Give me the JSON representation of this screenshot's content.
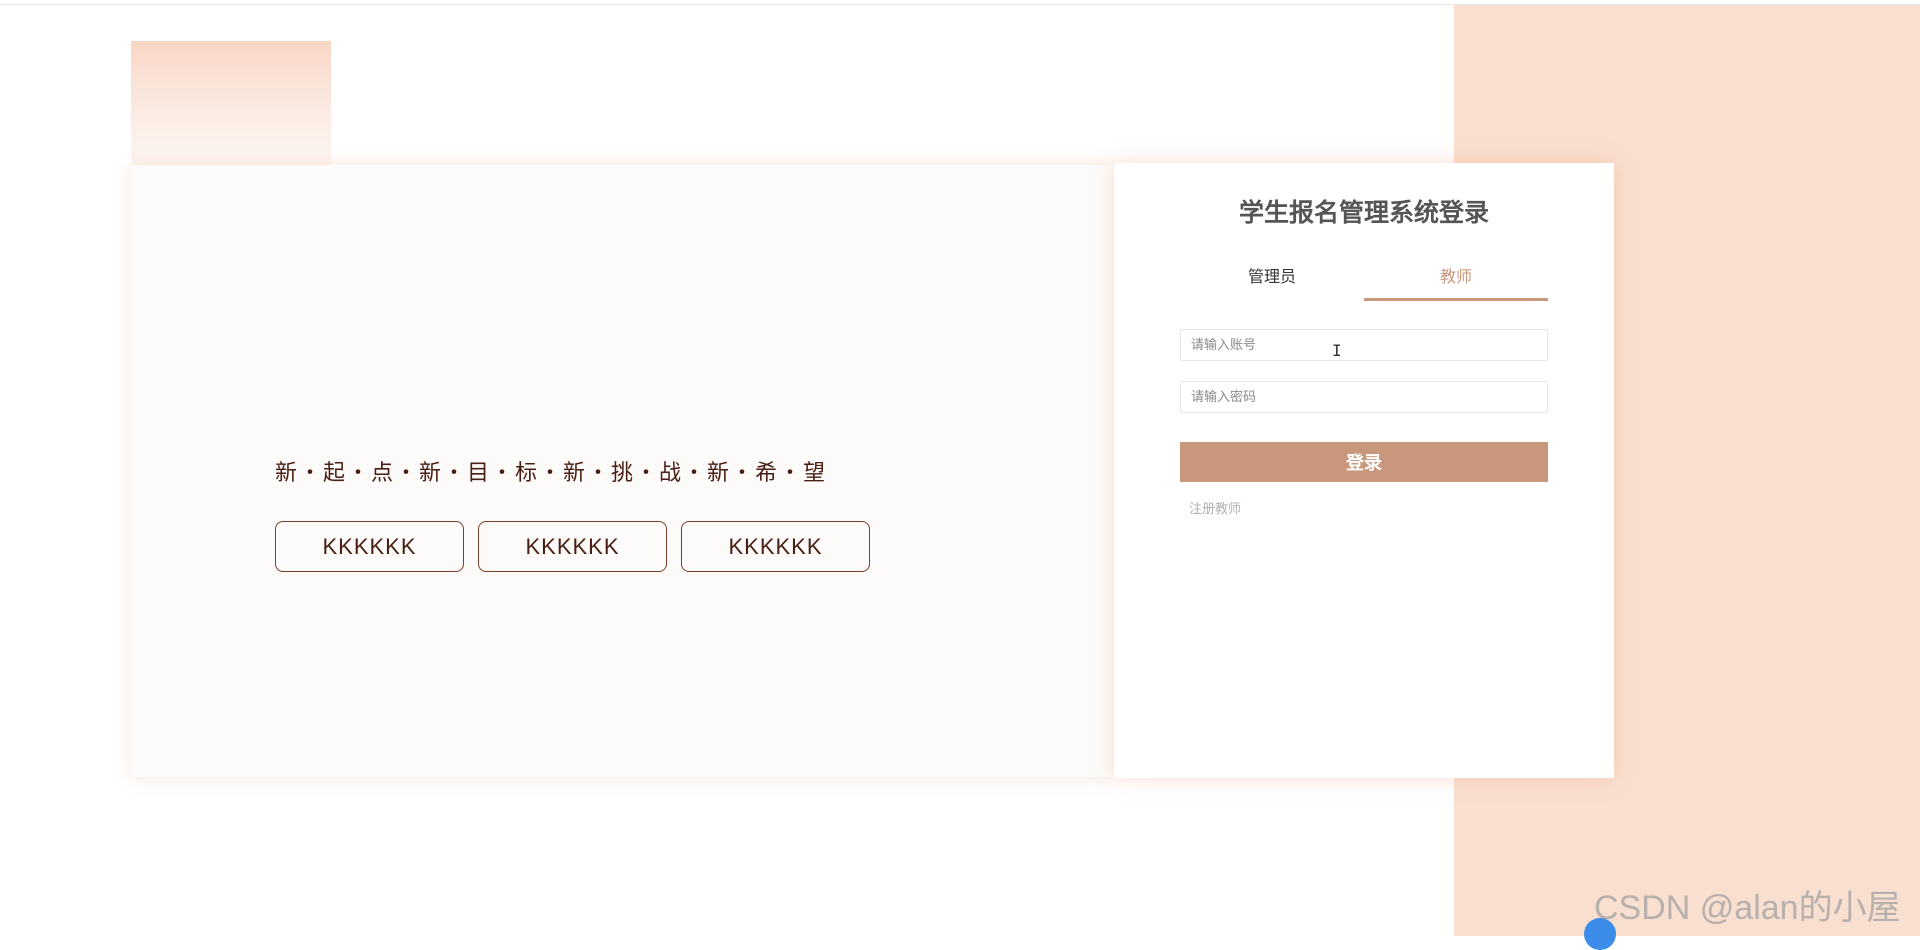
{
  "hero": {
    "slogan": "新・起・点・新・目・标・新・挑・战・新・希・望",
    "buttons": [
      "KKKKKK",
      "KKKKKK",
      "KKKKKK"
    ]
  },
  "login": {
    "title": "学生报名管理系统登录",
    "tabs": [
      {
        "label": "管理员",
        "active": false
      },
      {
        "label": "教师",
        "active": true
      }
    ],
    "account_placeholder": "请输入账号",
    "password_placeholder": "请输入密码",
    "submit_label": "登录",
    "register_label": "注册教师"
  },
  "watermark": "CSDN @alan的小屋",
  "colors": {
    "accent": "#c8977c",
    "side_panel": "#f9dfd0",
    "slogan_text": "#4a1e12"
  }
}
